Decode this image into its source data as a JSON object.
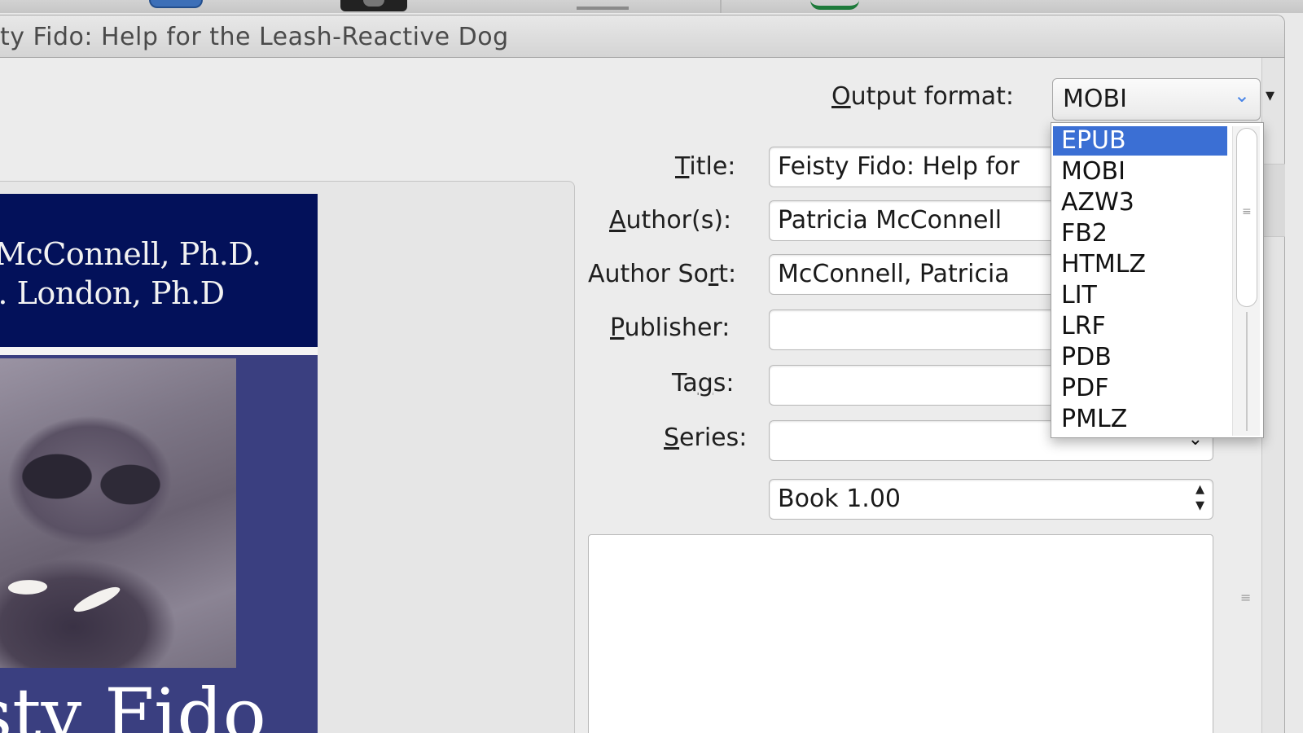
{
  "window": {
    "title": "ty Fido: Help for the Leash-Reactive Dog"
  },
  "cover": {
    "author_line_1": ". McConnell, Ph.D.",
    "author_line_2": "B. London, Ph.D",
    "title_fragment": "sty Fido",
    "colors": {
      "top_band": "#03115a",
      "body": "#3a3f80"
    }
  },
  "output_format": {
    "label_prefix": "",
    "label_mnemonic": "O",
    "label_rest": "utput format:",
    "selected": "MOBI",
    "options": [
      "EPUB",
      "MOBI",
      "AZW3",
      "FB2",
      "HTMLZ",
      "LIT",
      "LRF",
      "PDB",
      "PDF",
      "PMLZ"
    ],
    "highlighted": "EPUB"
  },
  "form": {
    "title": {
      "label_mnemonic": "T",
      "label_rest": "itle:",
      "value": "Feisty Fido: Help for"
    },
    "authors": {
      "label_mnemonic": "A",
      "label_rest": "uthor(s):",
      "value": "Patricia McConnell"
    },
    "author_sort": {
      "label_pre": "Author So",
      "label_mnemonic": "r",
      "label_rest": "t:",
      "value": "McConnell, Patricia"
    },
    "publisher": {
      "label_mnemonic": "P",
      "label_rest": "ublisher:",
      "value": ""
    },
    "tags": {
      "label_pre": "Ta",
      "label_mnemonic": "g",
      "label_rest": "s:",
      "value": ""
    },
    "series": {
      "label_mnemonic": "S",
      "label_rest": "eries:",
      "value": ""
    },
    "series_index": {
      "value": "Book 1.00"
    },
    "comments": {
      "value": ""
    }
  },
  "colors": {
    "highlight": "#3b6fd4",
    "chevron_accent": "#4a86e8"
  }
}
